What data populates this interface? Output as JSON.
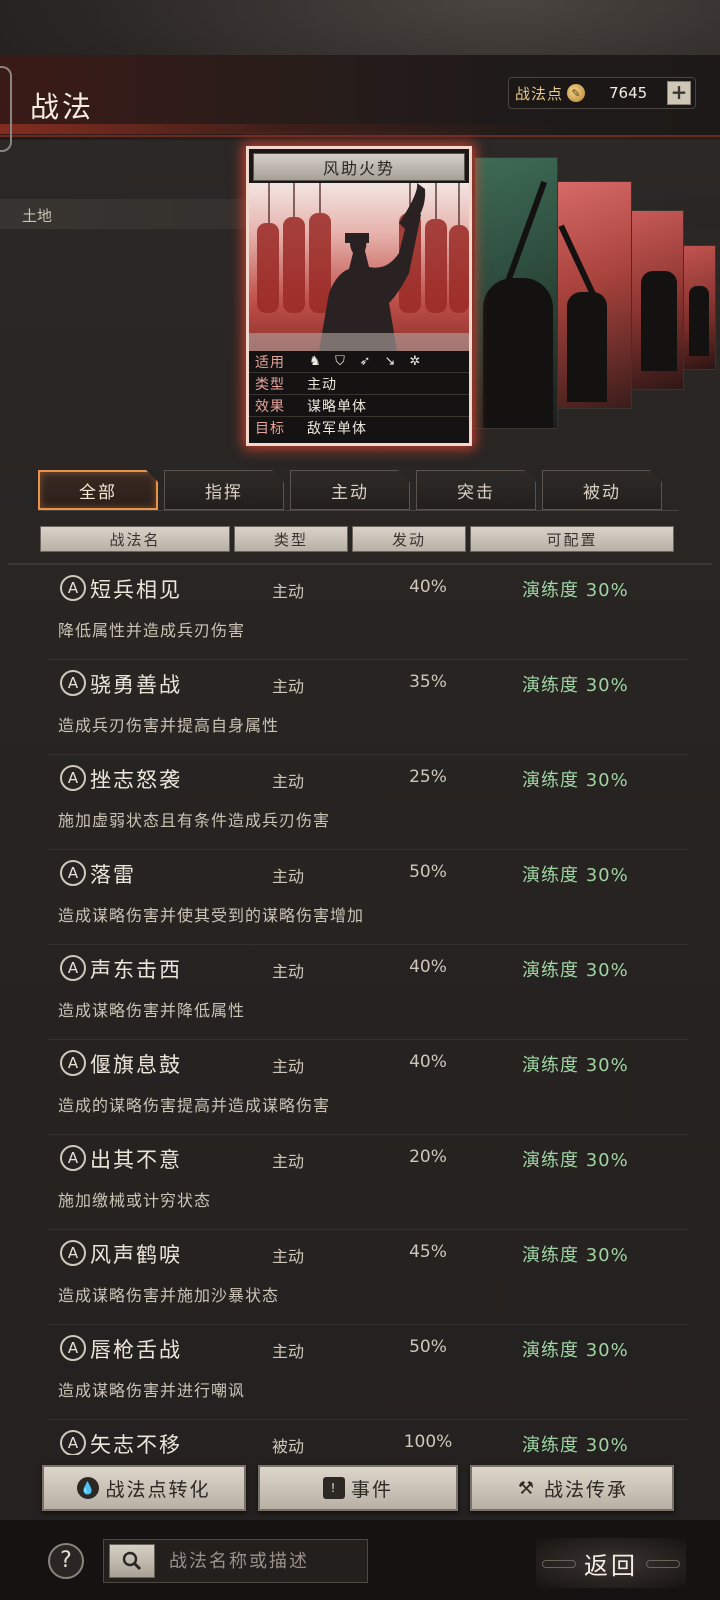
{
  "header": {
    "title": "战法",
    "points_label": "战法点",
    "points_value": "7645",
    "plus_symbol": "+"
  },
  "terrain_label": "土地",
  "featured_card": {
    "title": "风助火势",
    "rows": [
      {
        "key": "适用",
        "value": "",
        "icons": [
          "horse-icon",
          "shield-icon",
          "bow-icon",
          "spear-icon",
          "wheel-icon"
        ]
      },
      {
        "key": "类型",
        "value": "主动"
      },
      {
        "key": "效果",
        "value": "谋略单体"
      },
      {
        "key": "目标",
        "value": "敌军单体"
      }
    ]
  },
  "tabs": [
    {
      "label": "全部",
      "active": true
    },
    {
      "label": "指挥",
      "active": false
    },
    {
      "label": "主动",
      "active": false
    },
    {
      "label": "突击",
      "active": false
    },
    {
      "label": "被动",
      "active": false
    }
  ],
  "columns": [
    "战法名",
    "类型",
    "发动",
    "可配置"
  ],
  "rows": [
    {
      "grade": "A",
      "name": "短兵相见",
      "type": "主动",
      "rate": "40%",
      "config": "演练度 30%",
      "desc": "降低属性并造成兵刃伤害"
    },
    {
      "grade": "A",
      "name": "骁勇善战",
      "type": "主动",
      "rate": "35%",
      "config": "演练度 30%",
      "desc": "造成兵刃伤害并提高自身属性"
    },
    {
      "grade": "A",
      "name": "挫志怒袭",
      "type": "主动",
      "rate": "25%",
      "config": "演练度 30%",
      "desc": "施加虚弱状态且有条件造成兵刃伤害"
    },
    {
      "grade": "A",
      "name": "落雷",
      "type": "主动",
      "rate": "50%",
      "config": "演练度 30%",
      "desc": "造成谋略伤害并使其受到的谋略伤害增加"
    },
    {
      "grade": "A",
      "name": "声东击西",
      "type": "主动",
      "rate": "40%",
      "config": "演练度 30%",
      "desc": "造成谋略伤害并降低属性"
    },
    {
      "grade": "A",
      "name": "偃旗息鼓",
      "type": "主动",
      "rate": "40%",
      "config": "演练度 30%",
      "desc": "造成的谋略伤害提高并造成谋略伤害"
    },
    {
      "grade": "A",
      "name": "出其不意",
      "type": "主动",
      "rate": "20%",
      "config": "演练度 30%",
      "desc": "施加缴械或计穷状态"
    },
    {
      "grade": "A",
      "name": "风声鹤唳",
      "type": "主动",
      "rate": "45%",
      "config": "演练度 30%",
      "desc": "造成谋略伤害并施加沙暴状态"
    },
    {
      "grade": "A",
      "name": "唇枪舌战",
      "type": "主动",
      "rate": "50%",
      "config": "演练度 30%",
      "desc": "造成谋略伤害并进行嘲讽"
    },
    {
      "grade": "A",
      "name": "矢志不移",
      "type": "被动",
      "rate": "100%",
      "config": "演练度 30%",
      "desc": ""
    }
  ],
  "bottom_buttons": [
    {
      "label": "战法点转化",
      "icon": "drop-icon",
      "glyph": "💧"
    },
    {
      "label": "事件",
      "icon": "alert-icon",
      "glyph": "!"
    },
    {
      "label": "战法传承",
      "icon": "hammer-icon",
      "glyph": "⚒"
    }
  ],
  "search": {
    "placeholder": "战法名称或描述"
  },
  "help_symbol": "?",
  "back_label": "返回",
  "colors": {
    "accent": "#e9924a",
    "config_green": "#9fd3a3",
    "card_glow": "#e64632"
  }
}
